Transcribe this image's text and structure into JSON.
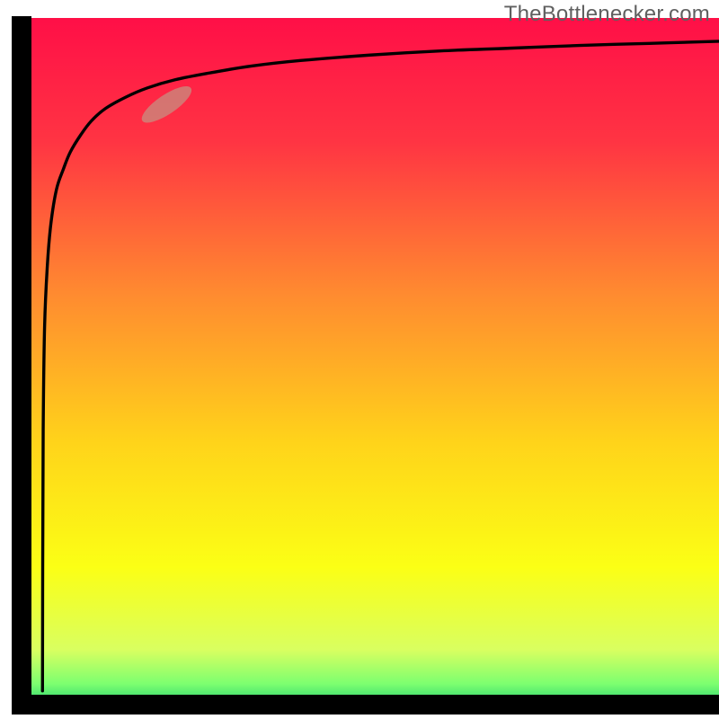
{
  "watermark": "TheBottlenecker.com",
  "chart_data": {
    "type": "line",
    "title": "",
    "xlabel": "",
    "ylabel": "",
    "xlim": [
      0,
      100
    ],
    "ylim": [
      0,
      100
    ],
    "background_gradient": {
      "direction": "vertical",
      "stops": [
        {
          "offset": 0.0,
          "color": "#ff0f47"
        },
        {
          "offset": 0.18,
          "color": "#ff3443"
        },
        {
          "offset": 0.4,
          "color": "#ff8a30"
        },
        {
          "offset": 0.62,
          "color": "#ffd41a"
        },
        {
          "offset": 0.8,
          "color": "#fbff15"
        },
        {
          "offset": 0.92,
          "color": "#d9ff60"
        },
        {
          "offset": 0.97,
          "color": "#7cff70"
        },
        {
          "offset": 1.0,
          "color": "#2bd36f"
        }
      ]
    },
    "series": [
      {
        "name": "curve",
        "stroke": "#000000",
        "x": [
          3.0,
          3.03,
          3.1,
          3.3,
          3.7,
          4.2,
          5.0,
          6.0,
          7.0,
          8.5,
          10,
          12,
          15,
          18,
          22,
          27,
          33,
          40,
          50,
          60,
          70,
          80,
          90,
          100
        ],
        "y": [
          2.0,
          20,
          40,
          55,
          64,
          70,
          75,
          78,
          80.5,
          83,
          85,
          86.8,
          88.5,
          89.8,
          91,
          92,
          93,
          93.8,
          94.6,
          95.2,
          95.6,
          96.0,
          96.3,
          96.6
        ]
      }
    ],
    "highlight": {
      "cx_pct": 20.8,
      "cy_pct": 87.4,
      "rx_pct": 4.2,
      "ry_pct": 1.4,
      "angle_deg": -34,
      "fill": "#c98b7e",
      "opacity": 0.78
    },
    "axes": {
      "color": "#000000",
      "x0_pct": 3.0,
      "x1_pct": 100.0,
      "y0_pct": 2.0,
      "y1_pct": 97.5
    }
  }
}
